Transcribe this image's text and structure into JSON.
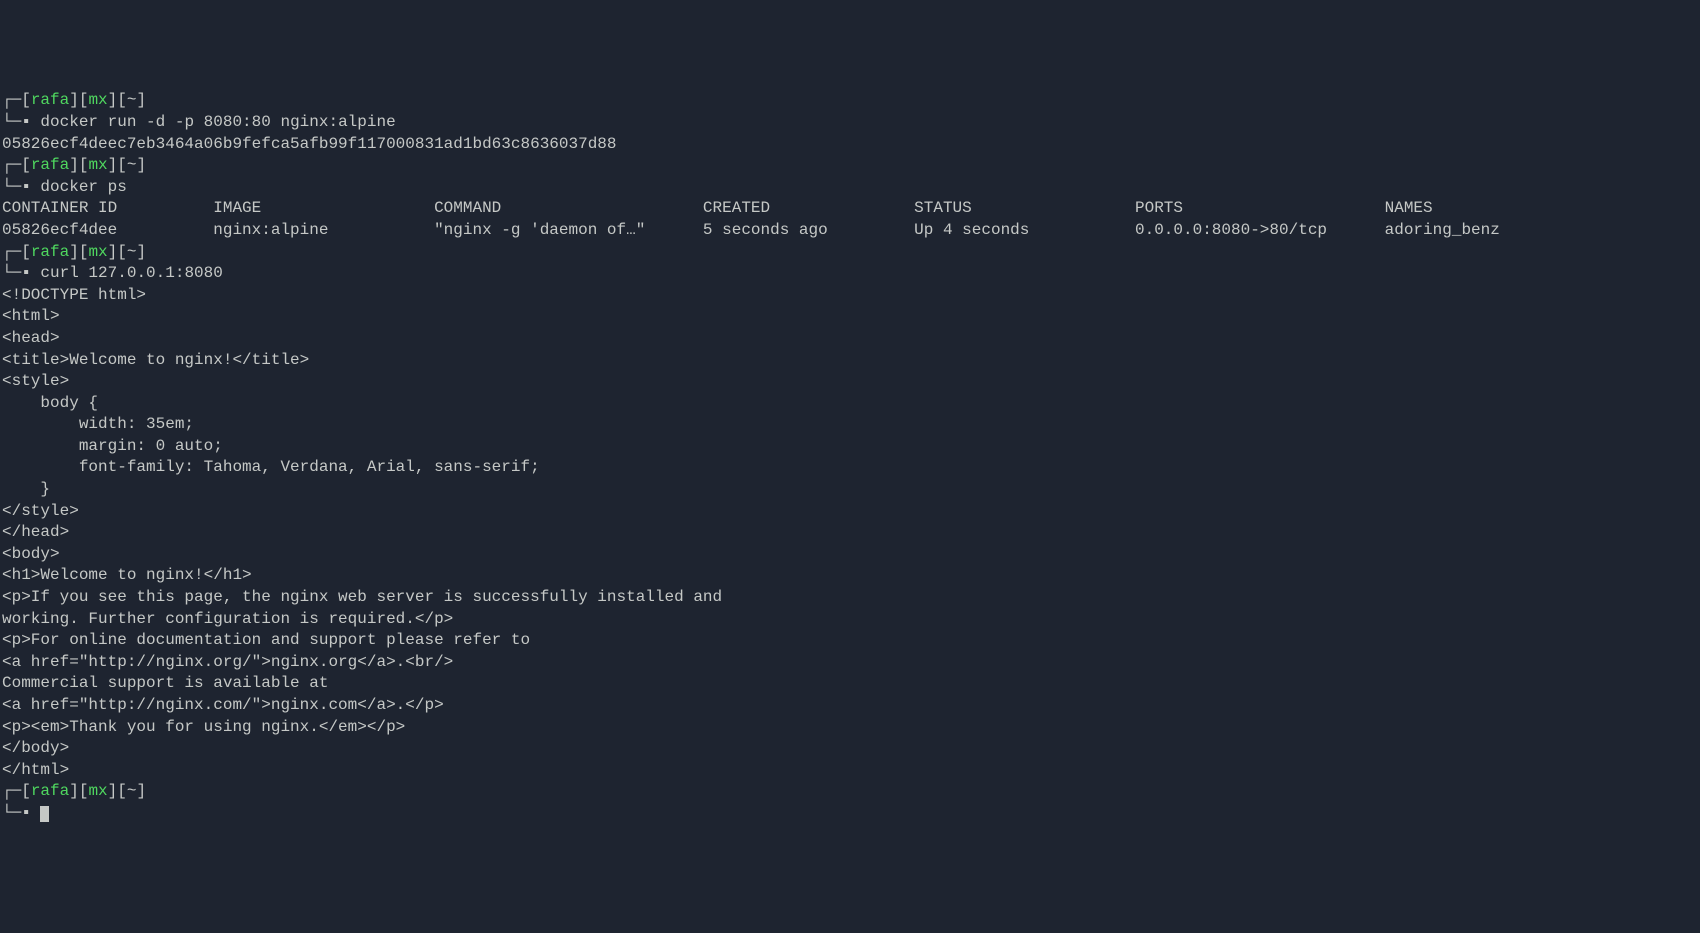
{
  "prompt": {
    "user": "rafa",
    "host": "mx",
    "path": "~",
    "open": "[",
    "close": "]",
    "top_left": "┌─",
    "bottom_left": "└─",
    "bullet": "▪"
  },
  "blocks": [
    {
      "command": "docker run -d -p 8080:80 nginx:alpine",
      "output": [
        "05826ecf4deec7eb3464a06b9fefca5afb99f117000831ad1bd63c8636037d88"
      ]
    },
    {
      "command": "docker ps",
      "table": {
        "headers": [
          "CONTAINER ID",
          "IMAGE",
          "COMMAND",
          "CREATED",
          "STATUS",
          "PORTS",
          "NAMES"
        ],
        "rows": [
          [
            "05826ecf4dee",
            "nginx:alpine",
            "\"nginx -g 'daemon of…\"",
            "5 seconds ago",
            "Up 4 seconds",
            "0.0.0.0:8080->80/tcp",
            "adoring_benz"
          ]
        ]
      }
    },
    {
      "command": "curl 127.0.0.1:8080",
      "output": [
        "<!DOCTYPE html>",
        "<html>",
        "<head>",
        "<title>Welcome to nginx!</title>",
        "<style>",
        "    body {",
        "        width: 35em;",
        "        margin: 0 auto;",
        "        font-family: Tahoma, Verdana, Arial, sans-serif;",
        "    }",
        "</style>",
        "</head>",
        "<body>",
        "<h1>Welcome to nginx!</h1>",
        "<p>If you see this page, the nginx web server is successfully installed and",
        "working. Further configuration is required.</p>",
        "",
        "<p>For online documentation and support please refer to",
        "<a href=\"http://nginx.org/\">nginx.org</a>.<br/>",
        "Commercial support is available at",
        "<a href=\"http://nginx.com/\">nginx.com</a>.</p>",
        "",
        "<p><em>Thank you for using nginx.</em></p>",
        "</body>",
        "</html>"
      ]
    },
    {
      "command": "",
      "cursor": true
    }
  ],
  "table_widths": [
    22,
    23,
    28,
    22,
    23,
    26,
    0
  ]
}
